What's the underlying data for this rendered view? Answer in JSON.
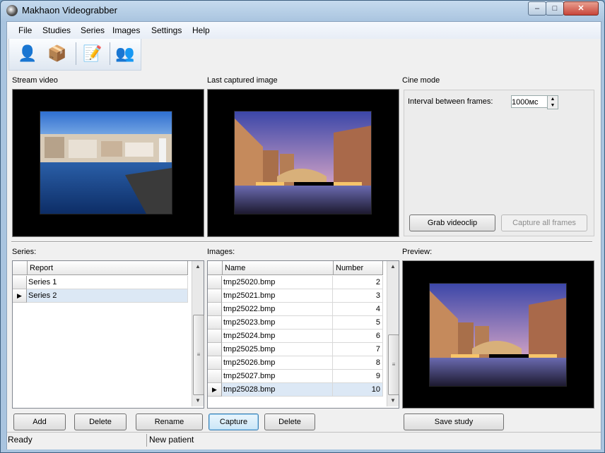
{
  "window": {
    "title": "Makhaon Videograbber",
    "min_label": "–",
    "max_label": "□",
    "close_label": "✕"
  },
  "menu": [
    "File",
    "Studies",
    "Series",
    "Images",
    "Settings",
    "Help"
  ],
  "toolbar": {
    "buttons": [
      {
        "icon": "new-patient-icon",
        "glyph": "👤"
      },
      {
        "icon": "open-study-icon",
        "glyph": "📦"
      },
      {
        "icon": "edit-notes-icon",
        "glyph": "📝"
      },
      {
        "icon": "patients-icon",
        "glyph": "👥"
      }
    ]
  },
  "sections": {
    "stream_video": "Stream video",
    "last_captured": "Last captured image",
    "cine_mode": "Cine mode",
    "series": "Series:",
    "images": "Images:",
    "preview": "Preview:"
  },
  "cine": {
    "interval_label": "Interval between frames:",
    "interval_value": "1000мс",
    "grab_label": "Grab videoclip",
    "capture_all_label": "Capture all frames"
  },
  "series_grid": {
    "header": "Report",
    "rows": [
      "Series 1",
      "Series 2"
    ],
    "selected_index": 1
  },
  "images_grid": {
    "headers": [
      "Name",
      "Number"
    ],
    "rows": [
      {
        "name": "tmp25020.bmp",
        "number": "2"
      },
      {
        "name": "tmp25021.bmp",
        "number": "3"
      },
      {
        "name": "tmp25022.bmp",
        "number": "4"
      },
      {
        "name": "tmp25023.bmp",
        "number": "5"
      },
      {
        "name": "tmp25024.bmp",
        "number": "6"
      },
      {
        "name": "tmp25025.bmp",
        "number": "7"
      },
      {
        "name": "tmp25026.bmp",
        "number": "8"
      },
      {
        "name": "tmp25027.bmp",
        "number": "9"
      },
      {
        "name": "tmp25028.bmp",
        "number": "10"
      }
    ],
    "selected_index": 8
  },
  "buttons": {
    "add": "Add",
    "delete_series": "Delete",
    "rename": "Rename",
    "capture": "Capture",
    "delete_image": "Delete",
    "save_study": "Save study"
  },
  "status": {
    "left": "Ready",
    "right": "New patient"
  }
}
